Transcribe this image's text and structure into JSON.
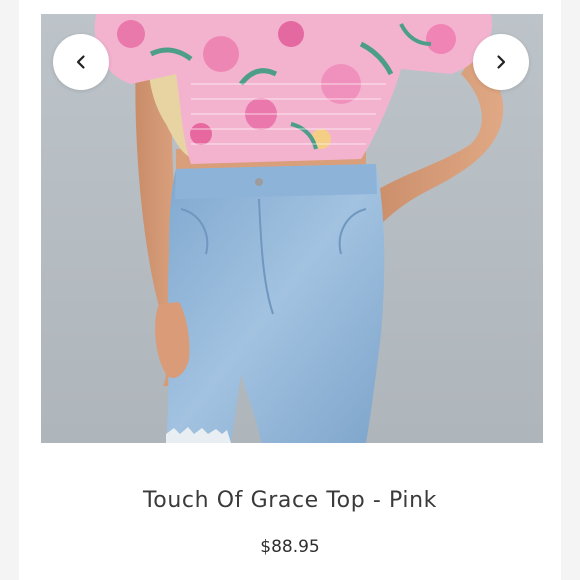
{
  "product": {
    "title": "Touch Of Grace Top - Pink",
    "price": "$88.95"
  },
  "gallery": {
    "prev_icon": "chevron-left-icon",
    "next_icon": "chevron-right-icon"
  },
  "colors": {
    "background": "#f4f4f4",
    "card": "#ffffff",
    "photo_backdrop": "#b7bec4",
    "top_pink": "#f3a6c8",
    "denim": "#8fb6da",
    "text": "#3a3a3a"
  }
}
